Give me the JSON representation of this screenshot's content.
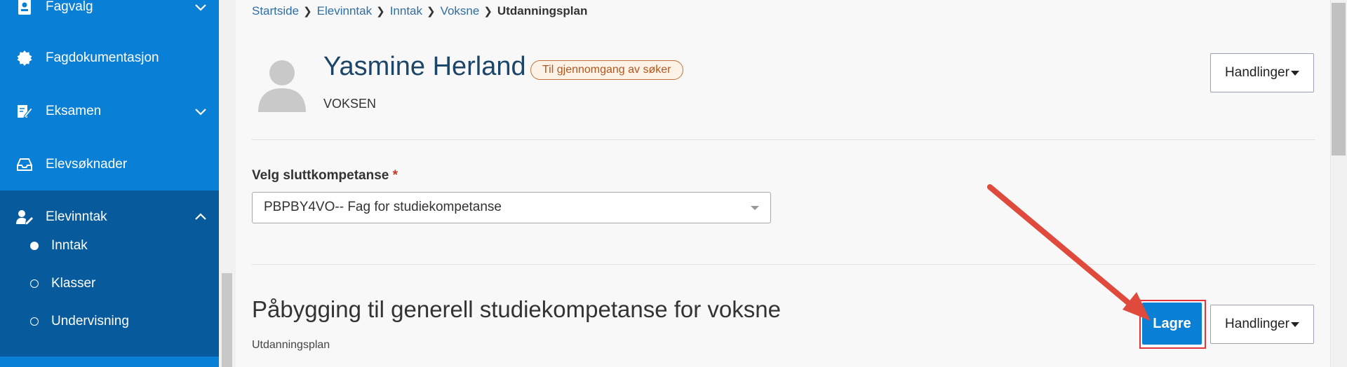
{
  "sidebar": {
    "items": [
      {
        "label": "Fagvalg",
        "icon": "id-card-icon"
      },
      {
        "label": "Fagdokumentasjon",
        "icon": "gear-badge-icon"
      },
      {
        "label": "Eksamen",
        "icon": "pen-paper-icon"
      },
      {
        "label": "Elevsøknader",
        "icon": "inbox-icon"
      },
      {
        "label": "Elevinntak",
        "icon": "user-edit-icon"
      }
    ],
    "sub_items": [
      {
        "label": "Inntak",
        "active": true
      },
      {
        "label": "Klasser",
        "active": false
      },
      {
        "label": "Undervisning",
        "active": false
      }
    ]
  },
  "breadcrumb": {
    "items": [
      "Startside",
      "Elevinntak",
      "Inntak",
      "Voksne"
    ],
    "current": "Utdanningsplan"
  },
  "profile": {
    "name": "Yasmine Herland",
    "badge": "Til gjennomgang av søker",
    "subtitle": "VOKSEN"
  },
  "actions": {
    "handlinger_label": "Handlinger",
    "save_label": "Lagre"
  },
  "form": {
    "label": "Velg sluttkompetanse",
    "required_marker": "*",
    "selected_value": "PBPBY4VO-- Fag for studiekompetanse"
  },
  "section": {
    "title": "Påbygging til generell studiekompetanse for voksne",
    "subtitle": "Utdanningsplan"
  },
  "colors": {
    "sidebar": "#0a7fd6",
    "sidebar_sub": "#075b9c",
    "primary_button": "#0a7fd6",
    "badge_border": "#c1733a",
    "highlight": "#e3343c"
  }
}
